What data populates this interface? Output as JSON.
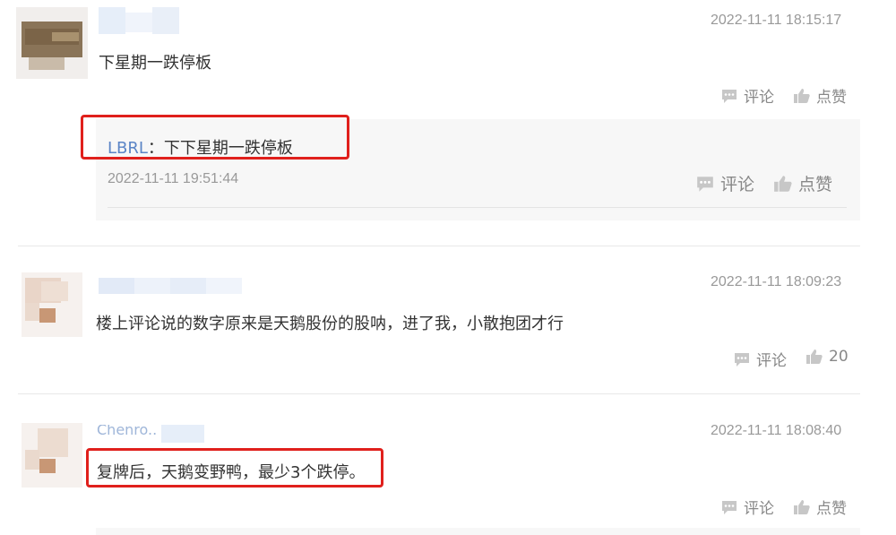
{
  "comments": [
    {
      "timestamp": "2022-11-11 18:15:17",
      "content": "下星期一跌停板",
      "actions": {
        "comment_label": "评论",
        "like_label": "点赞"
      },
      "reply": {
        "user": "LBRL",
        "separator": "：",
        "content": "下下星期一跌停板",
        "timestamp": "2022-11-11 19:51:44",
        "actions": {
          "comment_label": "评论",
          "like_label": "点赞"
        }
      }
    },
    {
      "timestamp": "2022-11-11 18:09:23",
      "content": "楼上评论说的数字原来是天鹅股份的股呐，进了我，小散抱团才行",
      "actions": {
        "comment_label": "评论",
        "like_label": "20"
      }
    },
    {
      "username_partial": "Chenro..",
      "timestamp": "2022-11-11 18:08:40",
      "content": "复牌后，天鹅变野鸭，最少3个跌停。",
      "actions": {
        "comment_label": "评论",
        "like_label": "点赞"
      }
    }
  ],
  "colors": {
    "highlight": "#e0201c",
    "link": "#5b85c6",
    "muted": "#999999"
  },
  "icons": [
    "comment-icon",
    "thumbs-up-icon"
  ]
}
